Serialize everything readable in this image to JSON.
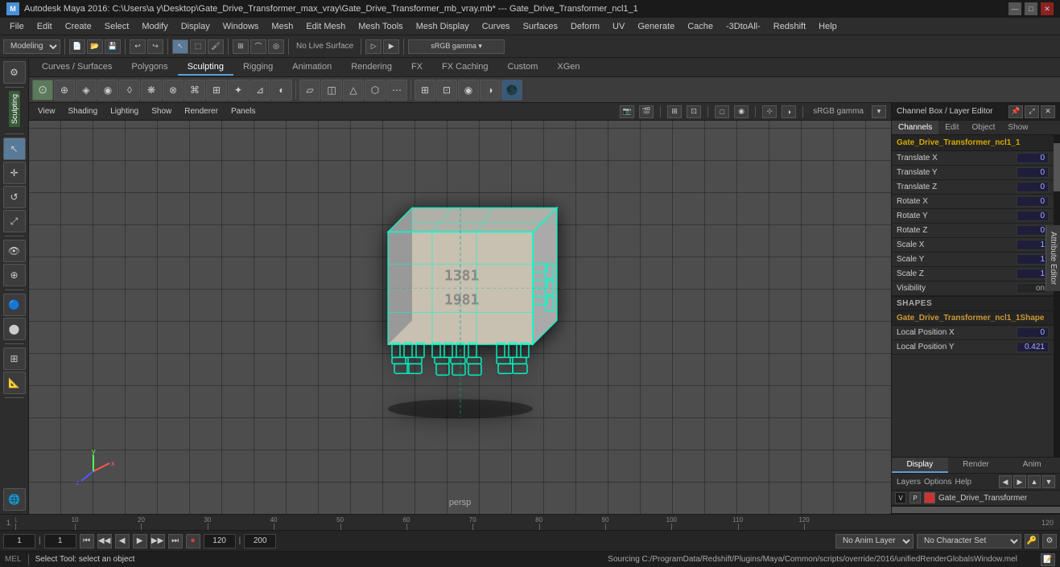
{
  "titleBar": {
    "icon": "M",
    "text": "Autodesk Maya 2016: C:\\Users\\a y\\Desktop\\Gate_Drive_Transformer_max_vray\\Gate_Drive_Transformer_mb_vray.mb* --- Gate_Drive_Transformer_ncl1_1",
    "minBtn": "—",
    "maxBtn": "□",
    "closeBtn": "✕"
  },
  "menuBar": {
    "items": [
      "File",
      "Edit",
      "Create",
      "Select",
      "Modify",
      "Display",
      "Windows",
      "Mesh",
      "Edit Mesh",
      "Mesh Tools",
      "Mesh Display",
      "Curves",
      "Surfaces",
      "Deform",
      "UV",
      "Generate",
      "Cache",
      "-3DtoAll-",
      "Redshift",
      "Help"
    ]
  },
  "toolbar1": {
    "dropdown": "Modeling",
    "liveLabel": "No Live Surface"
  },
  "tabs": {
    "items": [
      "Curves / Surfaces",
      "Polygons",
      "Sculpting",
      "Rigging",
      "Animation",
      "Rendering",
      "FX",
      "FX Caching",
      "Custom",
      "XGen"
    ],
    "active": 2
  },
  "viewportHeader": {
    "menuItems": [
      "View",
      "Shading",
      "Lighting",
      "Show",
      "Renderer",
      "Panels"
    ],
    "colorProfile": "sRGB gamma"
  },
  "viewport": {
    "label": "persp"
  },
  "channelBox": {
    "title": "Channel Box / Layer Editor",
    "tabs": [
      "Channels",
      "Edit",
      "Object",
      "Show"
    ],
    "objectName": "Gate_Drive_Transformer_ncl1_1",
    "channels": [
      {
        "name": "Translate X",
        "value": "0"
      },
      {
        "name": "Translate Y",
        "value": "0"
      },
      {
        "name": "Translate Z",
        "value": "0"
      },
      {
        "name": "Rotate X",
        "value": "0"
      },
      {
        "name": "Rotate Y",
        "value": "0"
      },
      {
        "name": "Rotate Z",
        "value": "0"
      },
      {
        "name": "Scale X",
        "value": "1"
      },
      {
        "name": "Scale Y",
        "value": "1"
      },
      {
        "name": "Scale Z",
        "value": "1"
      },
      {
        "name": "Visibility",
        "value": "on"
      }
    ],
    "shapesLabel": "SHAPES",
    "shapeName": "Gate_Drive_Transformer_ncl1_1Shape",
    "shapeChannels": [
      {
        "name": "Local Position X",
        "value": "0"
      },
      {
        "name": "Local Position Y",
        "value": "0.421"
      }
    ]
  },
  "displayTabs": {
    "items": [
      "Display",
      "Render",
      "Anim"
    ],
    "active": 0
  },
  "layerEditor": {
    "tabs": [
      "Layers",
      "Options",
      "Help"
    ],
    "layer": {
      "v": "V",
      "p": "P",
      "color": "#cc3333",
      "name": "Gate_Drive_Transformer"
    }
  },
  "timeline": {
    "start": "1",
    "end": "120",
    "marks": [
      "1",
      "10",
      "20",
      "30",
      "40",
      "50",
      "60",
      "70",
      "80",
      "90",
      "100",
      "110",
      "120"
    ],
    "currentFrame": "1"
  },
  "playback": {
    "frameStart": "1",
    "frameEnd": "120",
    "rangeEnd": "200",
    "animLayer": "No Anim Layer",
    "charSet": "No Character Set",
    "buttons": [
      "⏮",
      "⏪",
      "◀",
      "▶",
      "⏩",
      "⏭",
      "⏺"
    ]
  },
  "statusBar": {
    "melLabel": "MEL",
    "scriptText": "Sourcing C:/ProgramData/Redshift/Plugins/Maya/Common/scripts/override/2016/unifiedRenderGlobalsWindow.mel",
    "bottomStatus": "Select Tool: select an object"
  }
}
